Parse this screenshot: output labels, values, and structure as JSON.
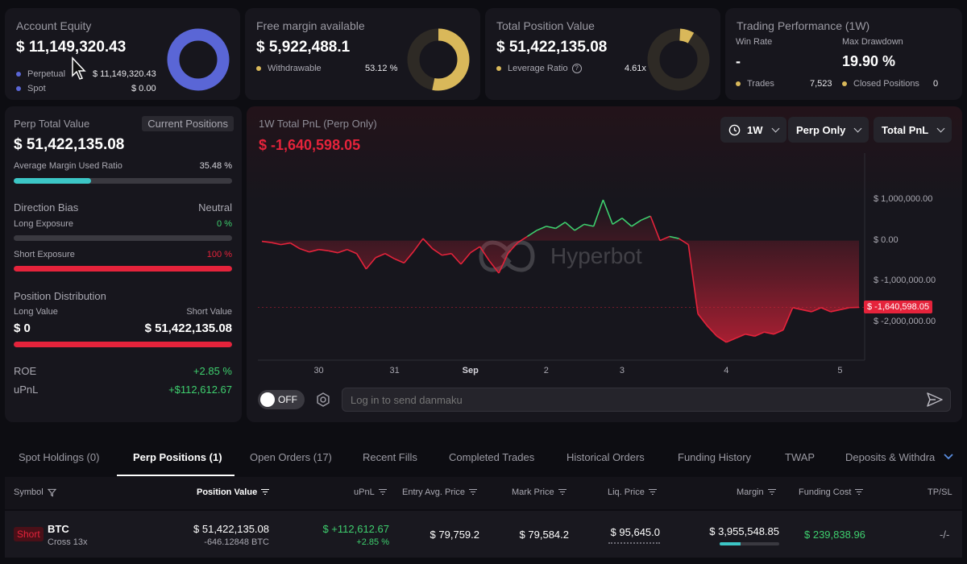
{
  "account_equity": {
    "title": "Account Equity",
    "value": "$ 11,149,320.43",
    "perpetual_label": "Perpetual",
    "perpetual_value": "$ 11,149,320.43",
    "spot_label": "Spot",
    "spot_value": "$ 0.00"
  },
  "free_margin": {
    "title": "Free margin available",
    "value": "$ 5,922,488.1",
    "withdrawable_label": "Withdrawable",
    "withdrawable_value": "53.12 %",
    "withdrawable_fraction": 0.5312
  },
  "total_position": {
    "title": "Total Position Value",
    "value": "$ 51,422,135.08",
    "leverage_label": "Leverage Ratio",
    "leverage_value": "4.61x"
  },
  "trading_performance": {
    "title": "Trading Performance (1W)",
    "win_rate_label": "Win Rate",
    "win_rate_value": "-",
    "max_drawdown_label": "Max Drawdown",
    "max_drawdown_value": "19.90 %",
    "trades_label": "Trades",
    "trades_value": "7,523",
    "closed_label": "Closed Positions",
    "closed_value": "0"
  },
  "perp_panel": {
    "title": "Perp Total Value",
    "current_positions_label": "Current Positions",
    "value": "$ 51,422,135.08",
    "avg_margin_label": "Average Margin Used Ratio",
    "avg_margin_value": "35.48 %",
    "avg_margin_fraction": 0.3548,
    "direction_label": "Direction Bias",
    "direction_value": "Neutral",
    "long_exposure_label": "Long Exposure",
    "long_exposure_value": "0 %",
    "short_exposure_label": "Short Exposure",
    "short_exposure_value": "100 %",
    "short_exposure_fraction": 1.0,
    "distribution_label": "Position Distribution",
    "long_value_label": "Long Value",
    "short_value_label": "Short Value",
    "long_value": "$ 0",
    "short_value": "$ 51,422,135.08",
    "roe_label": "ROE",
    "roe_value": "+2.85 %",
    "upnl_label": "uPnL",
    "upnl_value": "+$112,612.67"
  },
  "pnl_panel": {
    "title": "1W Total PnL (Perp Only)",
    "value": "$ -1,640,598.05",
    "period": "1W",
    "filter": "Perp Only",
    "metric": "Total PnL",
    "watermark": "Hyperbot",
    "current_label": "$ -1,640,598.05",
    "toggle_label": "OFF",
    "danmaku_placeholder": "Log in to send danmaku"
  },
  "chart_data": {
    "type": "line",
    "title": "1W Total PnL (Perp Only)",
    "xlabel": "",
    "ylabel": "",
    "x_ticks": [
      "30",
      "31",
      "Sep",
      "2",
      "3",
      "4",
      "5"
    ],
    "y_ticks": [
      "$ 1,000,000.00",
      "$ 0.00",
      "$ -1,000,000.00",
      "$ -2,000,000.00"
    ],
    "y_tick_values": [
      1000000,
      0,
      -1000000,
      -2000000
    ],
    "ylim": [
      -2900000,
      2150000
    ],
    "x_index_range": [
      0,
      63
    ],
    "x_tick_positions": [
      6,
      14,
      22,
      30,
      38,
      49,
      61
    ],
    "grid": false,
    "values": [
      -20000,
      -50000,
      -100000,
      -60000,
      -200000,
      -280000,
      -220000,
      -250000,
      -300000,
      -220000,
      -320000,
      -700000,
      -420000,
      -320000,
      -450000,
      -550000,
      -270000,
      50000,
      -200000,
      -360000,
      -320000,
      -580000,
      -300000,
      -150000,
      -500000,
      -800000,
      -300000,
      -50000,
      100000,
      250000,
      350000,
      300000,
      450000,
      250000,
      400000,
      350000,
      1000000,
      400000,
      550000,
      350000,
      500000,
      600000,
      0,
      100000,
      50000,
      -100000,
      -1800000,
      -2100000,
      -2350000,
      -2500000,
      -2400000,
      -2300000,
      -2350000,
      -2250000,
      -2300000,
      -2200000,
      -1650000,
      -1700000,
      -1750000,
      -1650000,
      -1750000,
      -1700000,
      -1650000,
      -1640598
    ]
  },
  "tabs": [
    {
      "label": "Spot Holdings (0)"
    },
    {
      "label": "Perp Positions (1)"
    },
    {
      "label": "Open Orders (17)"
    },
    {
      "label": "Recent Fills"
    },
    {
      "label": "Completed Trades"
    },
    {
      "label": "Historical Orders"
    },
    {
      "label": "Funding History"
    },
    {
      "label": "TWAP"
    },
    {
      "label": "Deposits & Withdra"
    }
  ],
  "table": {
    "headers": {
      "symbol": "Symbol",
      "position_value": "Position Value",
      "upnl": "uPnL",
      "entry": "Entry Avg. Price",
      "mark": "Mark Price",
      "liq": "Liq. Price",
      "margin": "Margin",
      "funding": "Funding Cost",
      "tpsl": "TP/SL"
    },
    "rows": [
      {
        "side": "Short",
        "symbol": "BTC",
        "leverage": "Cross 13x",
        "position_value": "$ 51,422,135.08",
        "position_size": "-646.12848 BTC",
        "upnl": "$ +112,612.67",
        "upnl_pct": "+2.85 %",
        "entry": "$ 79,759.2",
        "mark": "$ 79,584.2",
        "liq": "$ 95,645.0",
        "margin": "$ 3,955,548.85",
        "funding": "$ 239,838.96",
        "tpsl": "-/-"
      }
    ]
  },
  "colors": {
    "accent_blue": "#5a66d6",
    "gold": "#d9b85a",
    "green": "#3ecf6e",
    "red": "#e5233b",
    "teal": "#3cc6c6"
  }
}
